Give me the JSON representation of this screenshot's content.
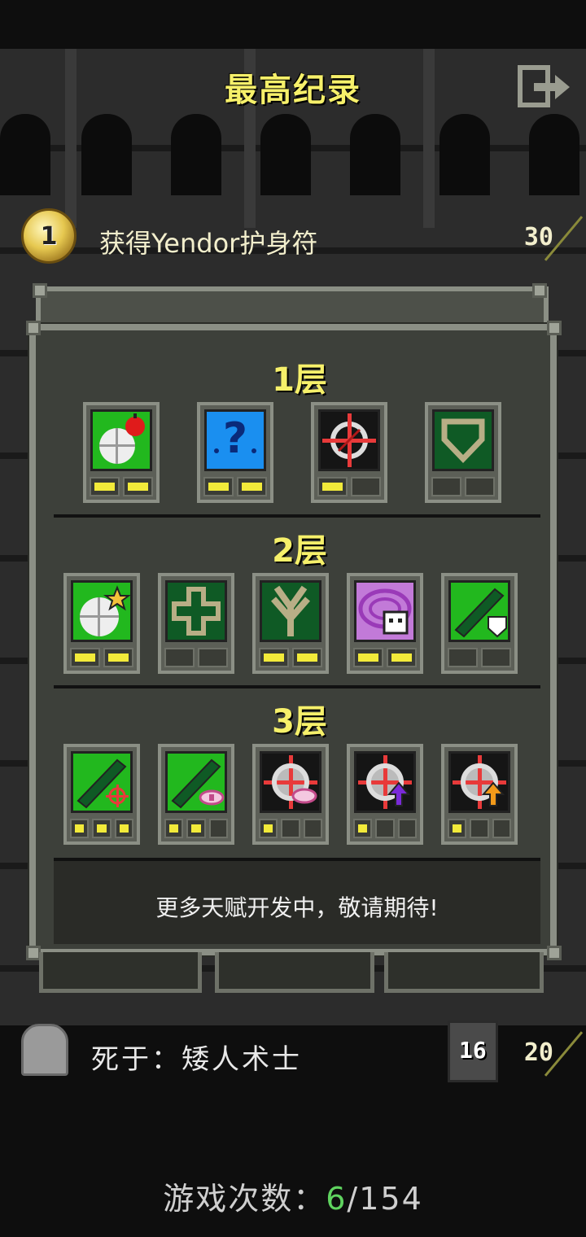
{
  "header": {
    "title": "最高纪录",
    "exit_icon": "exit-icon"
  },
  "top_record": {
    "rank": "1",
    "text": "获得Yendor护身符",
    "score": "30"
  },
  "talents": {
    "tiers": [
      {
        "label": "1层",
        "items": [
          {
            "icon": "hearty-meal-icon",
            "bg": "#22b81e",
            "pips_on": 2,
            "pips_total": 2
          },
          {
            "icon": "question-mark-icon",
            "bg": "#1a8ff0",
            "pips_on": 2,
            "pips_total": 2
          },
          {
            "icon": "crosshair-icon",
            "bg": "#151515",
            "pips_on": 1,
            "pips_total": 2
          },
          {
            "icon": "shield-icon",
            "bg": "#0f5a25",
            "pips_on": 0,
            "pips_total": 2
          }
        ]
      },
      {
        "label": "2层",
        "items": [
          {
            "icon": "plate-star-icon",
            "bg": "#22b81e",
            "pips_on": 2,
            "pips_total": 2
          },
          {
            "icon": "cross-icon",
            "bg": "#0f5a25",
            "pips_on": 0,
            "pips_total": 2
          },
          {
            "icon": "tree-root-icon",
            "bg": "#0f5a25",
            "pips_on": 2,
            "pips_total": 2
          },
          {
            "icon": "purple-spiral-skull-icon",
            "bg": "#c27ad8",
            "pips_on": 2,
            "pips_total": 2
          },
          {
            "icon": "rocket-shield-icon",
            "bg": "#22b81e",
            "pips_on": 0,
            "pips_total": 2
          }
        ]
      },
      {
        "label": "3层",
        "items": [
          {
            "icon": "rocket-target-icon",
            "bg": "#22b81e",
            "pips_on": 3,
            "pips_total": 3
          },
          {
            "icon": "rocket-eye-icon",
            "bg": "#22b81e",
            "pips_on": 2,
            "pips_total": 3
          },
          {
            "icon": "crosshair-eye-icon",
            "bg": "#151515",
            "pips_on": 1,
            "pips_total": 3
          },
          {
            "icon": "crosshair-purple-arrow-icon",
            "bg": "#151515",
            "pips_on": 1,
            "pips_total": 3
          },
          {
            "icon": "crosshair-orange-arrow-icon",
            "bg": "#151515",
            "pips_on": 1,
            "pips_total": 3
          }
        ]
      }
    ],
    "message": "更多天赋开发中，敬请期待!"
  },
  "death_record": {
    "text": "死于：矮人术士",
    "depth": "16",
    "score": "20"
  },
  "games": {
    "label": "游戏次数：",
    "current": "6",
    "total": "/154"
  }
}
